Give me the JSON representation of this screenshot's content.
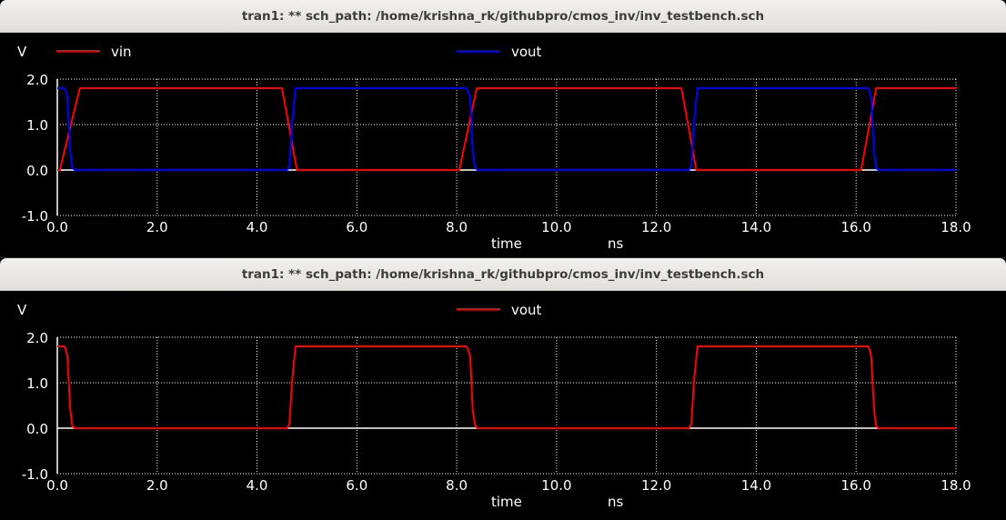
{
  "windows": [
    {
      "title": "tran1: ** sch_path: /home/krishna_rk/githubpro/cmos_inv/inv_testbench.sch",
      "chart_data": {
        "type": "line",
        "ylabel": "V",
        "xlabel": "time",
        "xunit": "ns",
        "xlim": [
          0,
          18
        ],
        "ylim": [
          -1,
          2
        ],
        "xticks": [
          "0.0",
          "2.0",
          "4.0",
          "6.0",
          "8.0",
          "10.0",
          "12.0",
          "14.0",
          "16.0",
          "18.0"
        ],
        "yticks": [
          "-1.0",
          "0.0",
          "1.0",
          "2.0"
        ],
        "grid": true,
        "legend": "top",
        "series": [
          {
            "name": "vin",
            "color": "#ff0000",
            "x": [
              0,
              0.05,
              0.45,
              4.5,
              4.8,
              8.05,
              8.4,
              12.5,
              12.8,
              16.1,
              16.4,
              18
            ],
            "y": [
              0,
              0,
              1.8,
              1.8,
              0,
              0,
              1.8,
              1.8,
              0,
              0,
              1.8,
              1.8
            ]
          },
          {
            "name": "vout",
            "color": "#0000ff",
            "x": [
              0,
              0.15,
              0.2,
              0.26,
              0.3,
              0.35,
              4.6,
              4.65,
              4.7,
              4.77,
              8.2,
              8.27,
              8.32,
              8.37,
              8.42,
              12.65,
              12.7,
              12.75,
              12.82,
              16.25,
              16.3,
              16.36,
              16.4,
              16.45,
              18
            ],
            "y": [
              1.8,
              1.8,
              1.6,
              0.4,
              0.05,
              0,
              0,
              0.1,
              1.0,
              1.8,
              1.8,
              1.6,
              0.4,
              0.05,
              0,
              0,
              0.1,
              1.0,
              1.8,
              1.8,
              1.6,
              0.4,
              0.05,
              0,
              0
            ]
          }
        ]
      }
    },
    {
      "title": "tran1: ** sch_path: /home/krishna_rk/githubpro/cmos_inv/inv_testbench.sch",
      "chart_data": {
        "type": "line",
        "ylabel": "V",
        "xlabel": "time",
        "xunit": "ns",
        "xlim": [
          0,
          18
        ],
        "ylim": [
          -1,
          2
        ],
        "xticks": [
          "0.0",
          "2.0",
          "4.0",
          "6.0",
          "8.0",
          "10.0",
          "12.0",
          "14.0",
          "16.0",
          "18.0"
        ],
        "yticks": [
          "-1.0",
          "0.0",
          "1.0",
          "2.0"
        ],
        "grid": true,
        "legend": "top",
        "series": [
          {
            "name": "vout",
            "color": "#ff0000",
            "x": [
              0,
              0.15,
              0.2,
              0.26,
              0.3,
              0.35,
              4.6,
              4.65,
              4.7,
              4.77,
              8.2,
              8.27,
              8.32,
              8.37,
              8.42,
              12.65,
              12.7,
              12.75,
              12.82,
              16.25,
              16.3,
              16.36,
              16.4,
              16.45,
              18
            ],
            "y": [
              1.8,
              1.8,
              1.6,
              0.4,
              0.05,
              0,
              0,
              0.1,
              1.0,
              1.8,
              1.8,
              1.6,
              0.4,
              0.05,
              0,
              0,
              0.1,
              1.0,
              1.8,
              1.8,
              1.6,
              0.4,
              0.05,
              0,
              0
            ]
          }
        ]
      }
    }
  ]
}
